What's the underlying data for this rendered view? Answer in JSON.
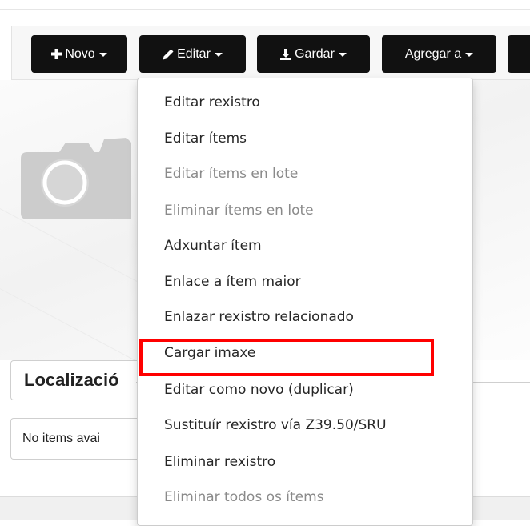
{
  "toolbar": {
    "buttons": [
      {
        "label": "Novo",
        "icon": "plus-icon"
      },
      {
        "label": "Editar",
        "icon": "pencil-icon"
      },
      {
        "label": "Gardar",
        "icon": "download-icon"
      },
      {
        "label": "Agregar a",
        "icon": ""
      }
    ]
  },
  "section": {
    "location_title": "Localizació",
    "no_items_text": "No items avai"
  },
  "edit_menu": {
    "items": [
      {
        "label": "Editar rexistro",
        "enabled": true
      },
      {
        "label": "Editar ítems",
        "enabled": true
      },
      {
        "label": "Editar ítems en lote",
        "enabled": false
      },
      {
        "label": "Eliminar ítems en lote",
        "enabled": false
      },
      {
        "label": "Adxuntar ítem",
        "enabled": true
      },
      {
        "label": "Enlace a ítem maior",
        "enabled": true
      },
      {
        "label": "Enlazar rexistro relacionado",
        "enabled": true
      },
      {
        "label": "Cargar imaxe",
        "enabled": true,
        "highlighted": true
      },
      {
        "label": "Editar como novo (duplicar)",
        "enabled": true
      },
      {
        "label": "Sustituír rexistro vía Z39.50/SRU",
        "enabled": true
      },
      {
        "label": "Eliminar rexistro",
        "enabled": true
      },
      {
        "label": "Eliminar todos os ítems",
        "enabled": false
      }
    ]
  },
  "colors": {
    "button_bg": "#111111",
    "highlight_border": "#ff0000",
    "disabled_text": "#8a8a8a"
  }
}
